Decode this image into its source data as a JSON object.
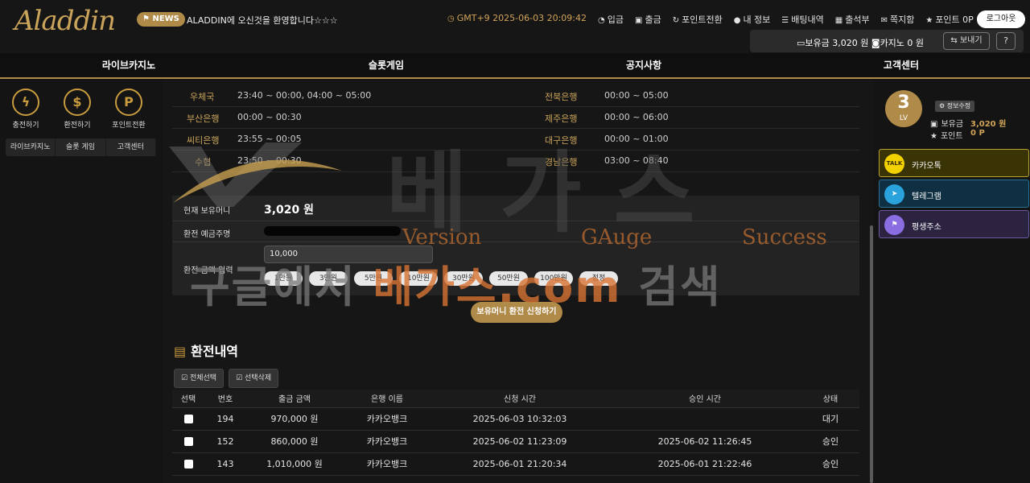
{
  "header": {
    "logo": "Aladdin",
    "news_badge": "NEWS",
    "news_text": "ALADDIN에 오신것을 환영합니다☆☆☆",
    "clock": "GMT+9 2025-06-03 20:09:42",
    "links": [
      "입금",
      "출금",
      "포인트전환",
      "내 정보",
      "배팅내역",
      "출석부",
      "쪽지함",
      "포인트 0P"
    ],
    "logout": "로그아웃",
    "balance_text": "보유금 3,020 원",
    "casino_text": "카지노 0 원",
    "send_btn": "보내기",
    "help_btn": "?"
  },
  "nav": [
    "라이브카지노",
    "슬롯게임",
    "공지사항",
    "고객센터"
  ],
  "left": {
    "quick": [
      {
        "label": "충전하기",
        "icon": "lightning-icon",
        "glyph": "ϟ"
      },
      {
        "label": "환전하기",
        "icon": "dollar-icon",
        "glyph": "$"
      },
      {
        "label": "포인트전환",
        "icon": "point-icon",
        "glyph": "P"
      }
    ],
    "tabs": [
      "라이브카지노",
      "슬롯 게임",
      "고객센터"
    ]
  },
  "banks": [
    {
      "name1": "우체국",
      "time1": "23:40 ~ 00:00, 04:00 ~ 05:00",
      "name2": "전북은행",
      "time2": "00:00 ~ 05:00"
    },
    {
      "name1": "부산은행",
      "time1": "00:00 ~ 00:30",
      "name2": "제주은행",
      "time2": "00:00 ~ 06:00"
    },
    {
      "name1": "씨티은행",
      "time1": "23:55 ~ 00:05",
      "name2": "대구은행",
      "time2": "00:00 ~ 01:00"
    },
    {
      "name1": "수협",
      "time1": "23:50 ~ 00:30",
      "name2": "경남은행",
      "time2": "03:00 ~ 08:40"
    }
  ],
  "form": {
    "balance_label": "현재 보유머니",
    "balance_value": "3,020 원",
    "holder_label": "환전 예금주명",
    "amount_label": "환전 금액 입력",
    "amount_value": "10,000",
    "amount_buttons": [
      "1만원",
      "3만원",
      "5만원",
      "10만원",
      "30만원",
      "50만원",
      "100만원",
      "정정"
    ],
    "apply_btn": "보유머니 환전 신청하기"
  },
  "history": {
    "title": "환전내역",
    "select_all": "전체선택",
    "delete_selected": "선택삭제",
    "columns": [
      "선택",
      "번호",
      "출금 금액",
      "은행 이름",
      "신청 시간",
      "승인 시간",
      "상태"
    ],
    "rows": [
      {
        "no": "194",
        "amount": "970,000 원",
        "bank": "카카오뱅크",
        "req": "2025-06-03 10:32:03",
        "appr": "",
        "status": "대기"
      },
      {
        "no": "152",
        "amount": "860,000 원",
        "bank": "카카오뱅크",
        "req": "2025-06-02 11:23:09",
        "appr": "2025-06-02 11:26:45",
        "status": "승인"
      },
      {
        "no": "143",
        "amount": "1,010,000 원",
        "bank": "카카오뱅크",
        "req": "2025-06-01 21:20:34",
        "appr": "2025-06-01 21:22:46",
        "status": "승인"
      }
    ]
  },
  "right": {
    "level_num": "3",
    "level_label": "LV",
    "info_edit": "정보수정",
    "balance_label": "보유금",
    "balance_value": "3,020 원",
    "point_label": "포인트",
    "point_value": "0 P",
    "socials": [
      {
        "label": "카카오톡",
        "icon": "kakaotalk-icon",
        "glyph": "TALK"
      },
      {
        "label": "텔레그램",
        "icon": "telegram-icon",
        "glyph": "➤"
      },
      {
        "label": "평생주소",
        "icon": "flag-icon",
        "glyph": "⚑"
      }
    ]
  },
  "watermark": {
    "big": "베가스",
    "words": [
      "Version",
      "GAuge",
      "Success"
    ],
    "line_a": "구글에서 ",
    "line_b": "베가스.com",
    "line_c": " 검색"
  },
  "colors": {
    "gold": "#b08a48",
    "bg": "#141414",
    "kakao": "#f2d100",
    "telegram": "#2aa3dd",
    "address": "#8a6de0"
  }
}
